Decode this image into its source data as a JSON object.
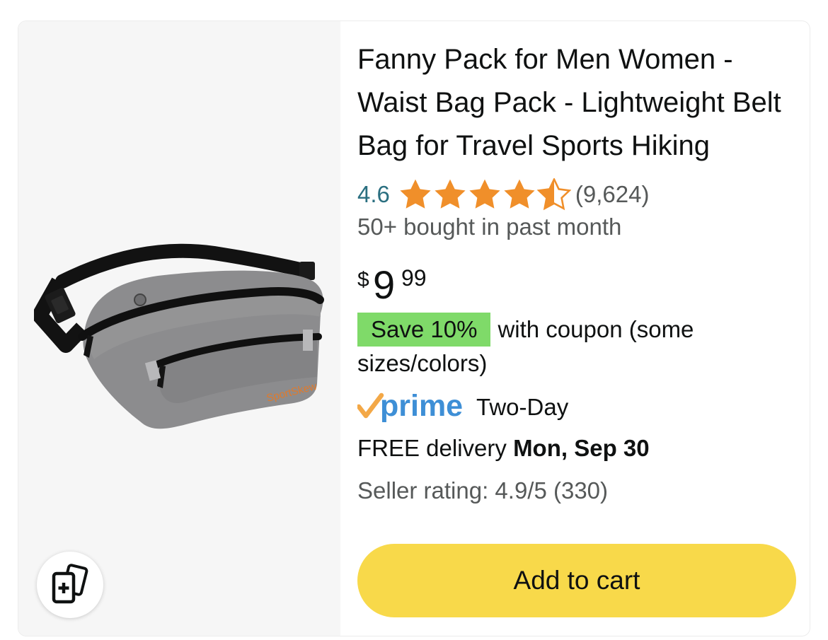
{
  "product": {
    "title": "Fanny Pack for Men Women - Waist Bag Pack - Lightweight Belt Bag for Travel Sports Hiking",
    "image_brand_text": "SportSkew",
    "rating": {
      "value": "4.6",
      "stars_filled": 4.5,
      "stars_max": 5,
      "count": "(9,624)"
    },
    "bought_text": "50+ bought in past month",
    "price": {
      "symbol": "$",
      "whole": "9",
      "fraction": "99"
    },
    "coupon": {
      "badge": "Save 10%",
      "text": "with coupon (some sizes/colors)"
    },
    "shipping": {
      "prime_logo": "prime",
      "speed": "Two-Day",
      "delivery_prefix": "FREE delivery",
      "delivery_date": "Mon, Sep 30"
    },
    "seller_rating": "Seller rating: 4.9/5 (330)",
    "add_to_cart_label": "Add to cart"
  },
  "icons": {
    "compare": "compare-cards-icon",
    "star": "star-icon",
    "prime_check": "prime-check-icon"
  },
  "colors": {
    "star": "#f08f2a",
    "rating_link": "#2a6f80",
    "coupon_badge": "#7fda69",
    "prime_blue": "#3e8fd6",
    "prime_check": "#f3a847",
    "cart_button": "#f8d94a",
    "image_background": "#f6f6f6"
  }
}
